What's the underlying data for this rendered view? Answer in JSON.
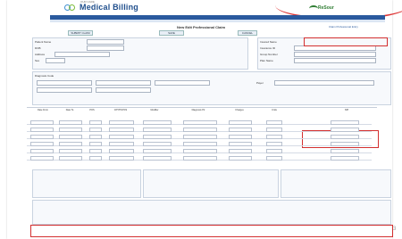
{
  "brand": {
    "title": "Medical Billing",
    "tagline": "OUR CARE",
    "partner": "ReSour"
  },
  "nav": {
    "items": [
      "Home",
      "Patient",
      "Referral",
      "Encounter",
      "Scheduling",
      "Batch",
      "Claims",
      "Reports",
      "Setup",
      "Clinical",
      "Help"
    ]
  },
  "page": {
    "title": "New Edit Professional Claim",
    "top_link": "Claim Professional Entry"
  },
  "buttons": {
    "tab1": "SUBMIT CLAIM",
    "tab2": "SAVE",
    "tab3": "CANCEL"
  },
  "claim_form": {
    "patient_label": "Patient Name",
    "dob_label": "DOB",
    "address_label": "Address",
    "sex_label": "Sex",
    "insured_label": "Insured Name",
    "id_label": "Insurance ID",
    "fields": [
      "Group Number",
      "Plan Name",
      "Payer"
    ],
    "diagnosis_label": "Diagnosis Code",
    "service_header": [
      "Date From",
      "Date To",
      "POS",
      "CPT/HCPCS",
      "Modifier",
      "Diagnosis Ptr",
      "Charges",
      "Units",
      "NPI"
    ]
  },
  "footer": {
    "page_number": "3"
  }
}
